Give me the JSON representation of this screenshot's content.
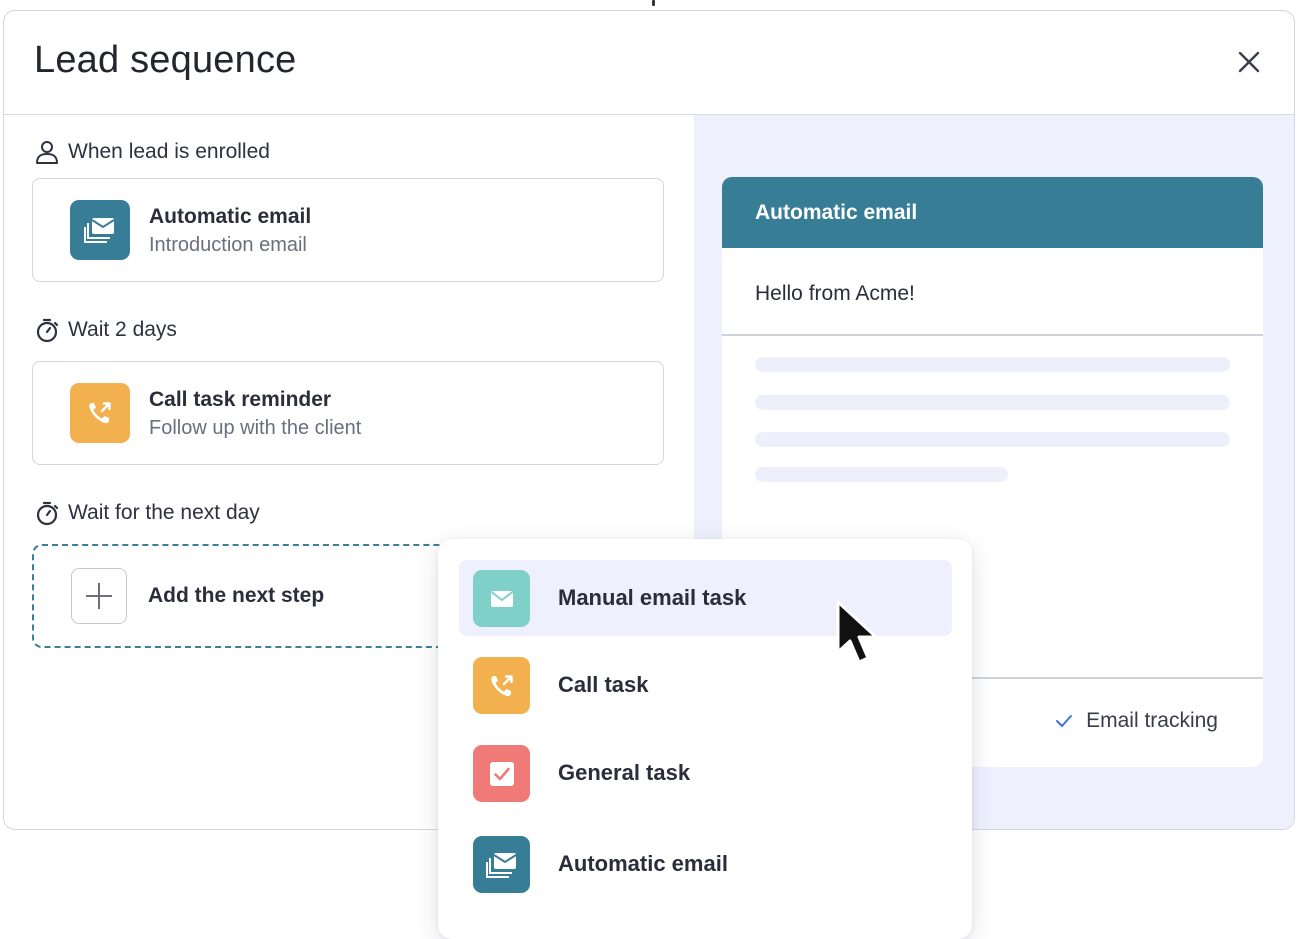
{
  "modal": {
    "title": "Lead sequence"
  },
  "sequence": {
    "trigger_label": "When lead is enrolled",
    "steps": [
      {
        "title": "Automatic email",
        "subtitle": "Introduction email",
        "icon": "stacked-mail-icon",
        "color": "#377d96"
      },
      {
        "title": "Call task reminder",
        "subtitle": "Follow up with the client",
        "icon": "phone-callback-icon",
        "color": "#f2b04e"
      }
    ],
    "wait_labels": [
      "Wait 2 days",
      "Wait for the next day"
    ],
    "add_step_label": "Add the next step"
  },
  "preview": {
    "header": "Automatic email",
    "subject": "Hello from Acme!",
    "tracking_label": "Email tracking",
    "tracking_checked": true
  },
  "dropdown": {
    "items": [
      {
        "label": "Manual email task",
        "icon": "mail-icon",
        "color": "#7ed0c8",
        "active": true
      },
      {
        "label": "Call task",
        "icon": "phone-callback-icon",
        "color": "#f2b04e",
        "active": false
      },
      {
        "label": "General task",
        "icon": "checkbox-icon",
        "color": "#ef7a78",
        "active": false
      },
      {
        "label": "Automatic email",
        "icon": "stacked-mail-icon",
        "color": "#377d96",
        "active": false
      }
    ]
  },
  "colors": {
    "accent": "#377d96",
    "pane_background": "#eef1fd"
  }
}
